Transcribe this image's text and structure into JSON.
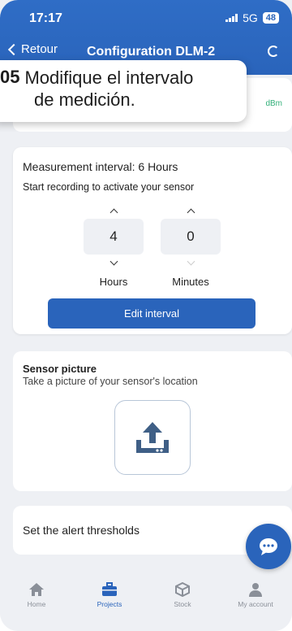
{
  "status_bar": {
    "time": "17:17",
    "network": "5G",
    "battery": "48"
  },
  "nav": {
    "back_label": "Retour",
    "title": "Configuration DLM-2"
  },
  "top_card": {
    "unit": "dBm"
  },
  "callout": {
    "number": "05",
    "line1": "Modifique el intervalo",
    "line2": "de medición."
  },
  "measurement": {
    "title": "Measurement interval: 6 Hours",
    "subtitle": "Start recording to activate your sensor",
    "hours_value": "4",
    "hours_label": "Hours",
    "minutes_value": "0",
    "minutes_label": "Minutes",
    "edit_button": "Edit interval"
  },
  "sensor_picture": {
    "title": "Sensor picture",
    "subtitle": "Take a picture of your sensor's location",
    "upload_icon": "upload-icon"
  },
  "alert": {
    "label": "Set the alert thresholds"
  },
  "chat": {
    "icon": "chat-icon"
  },
  "tabs": [
    {
      "label": "Home",
      "icon": "home-icon",
      "active": false
    },
    {
      "label": "Projects",
      "icon": "briefcase-icon",
      "active": true
    },
    {
      "label": "Stock",
      "icon": "box-icon",
      "active": false
    },
    {
      "label": "My account",
      "icon": "user-icon",
      "active": false
    }
  ],
  "colors": {
    "primary": "#2a64bb",
    "background": "#eef0f4",
    "accent_green": "#33b07a"
  }
}
